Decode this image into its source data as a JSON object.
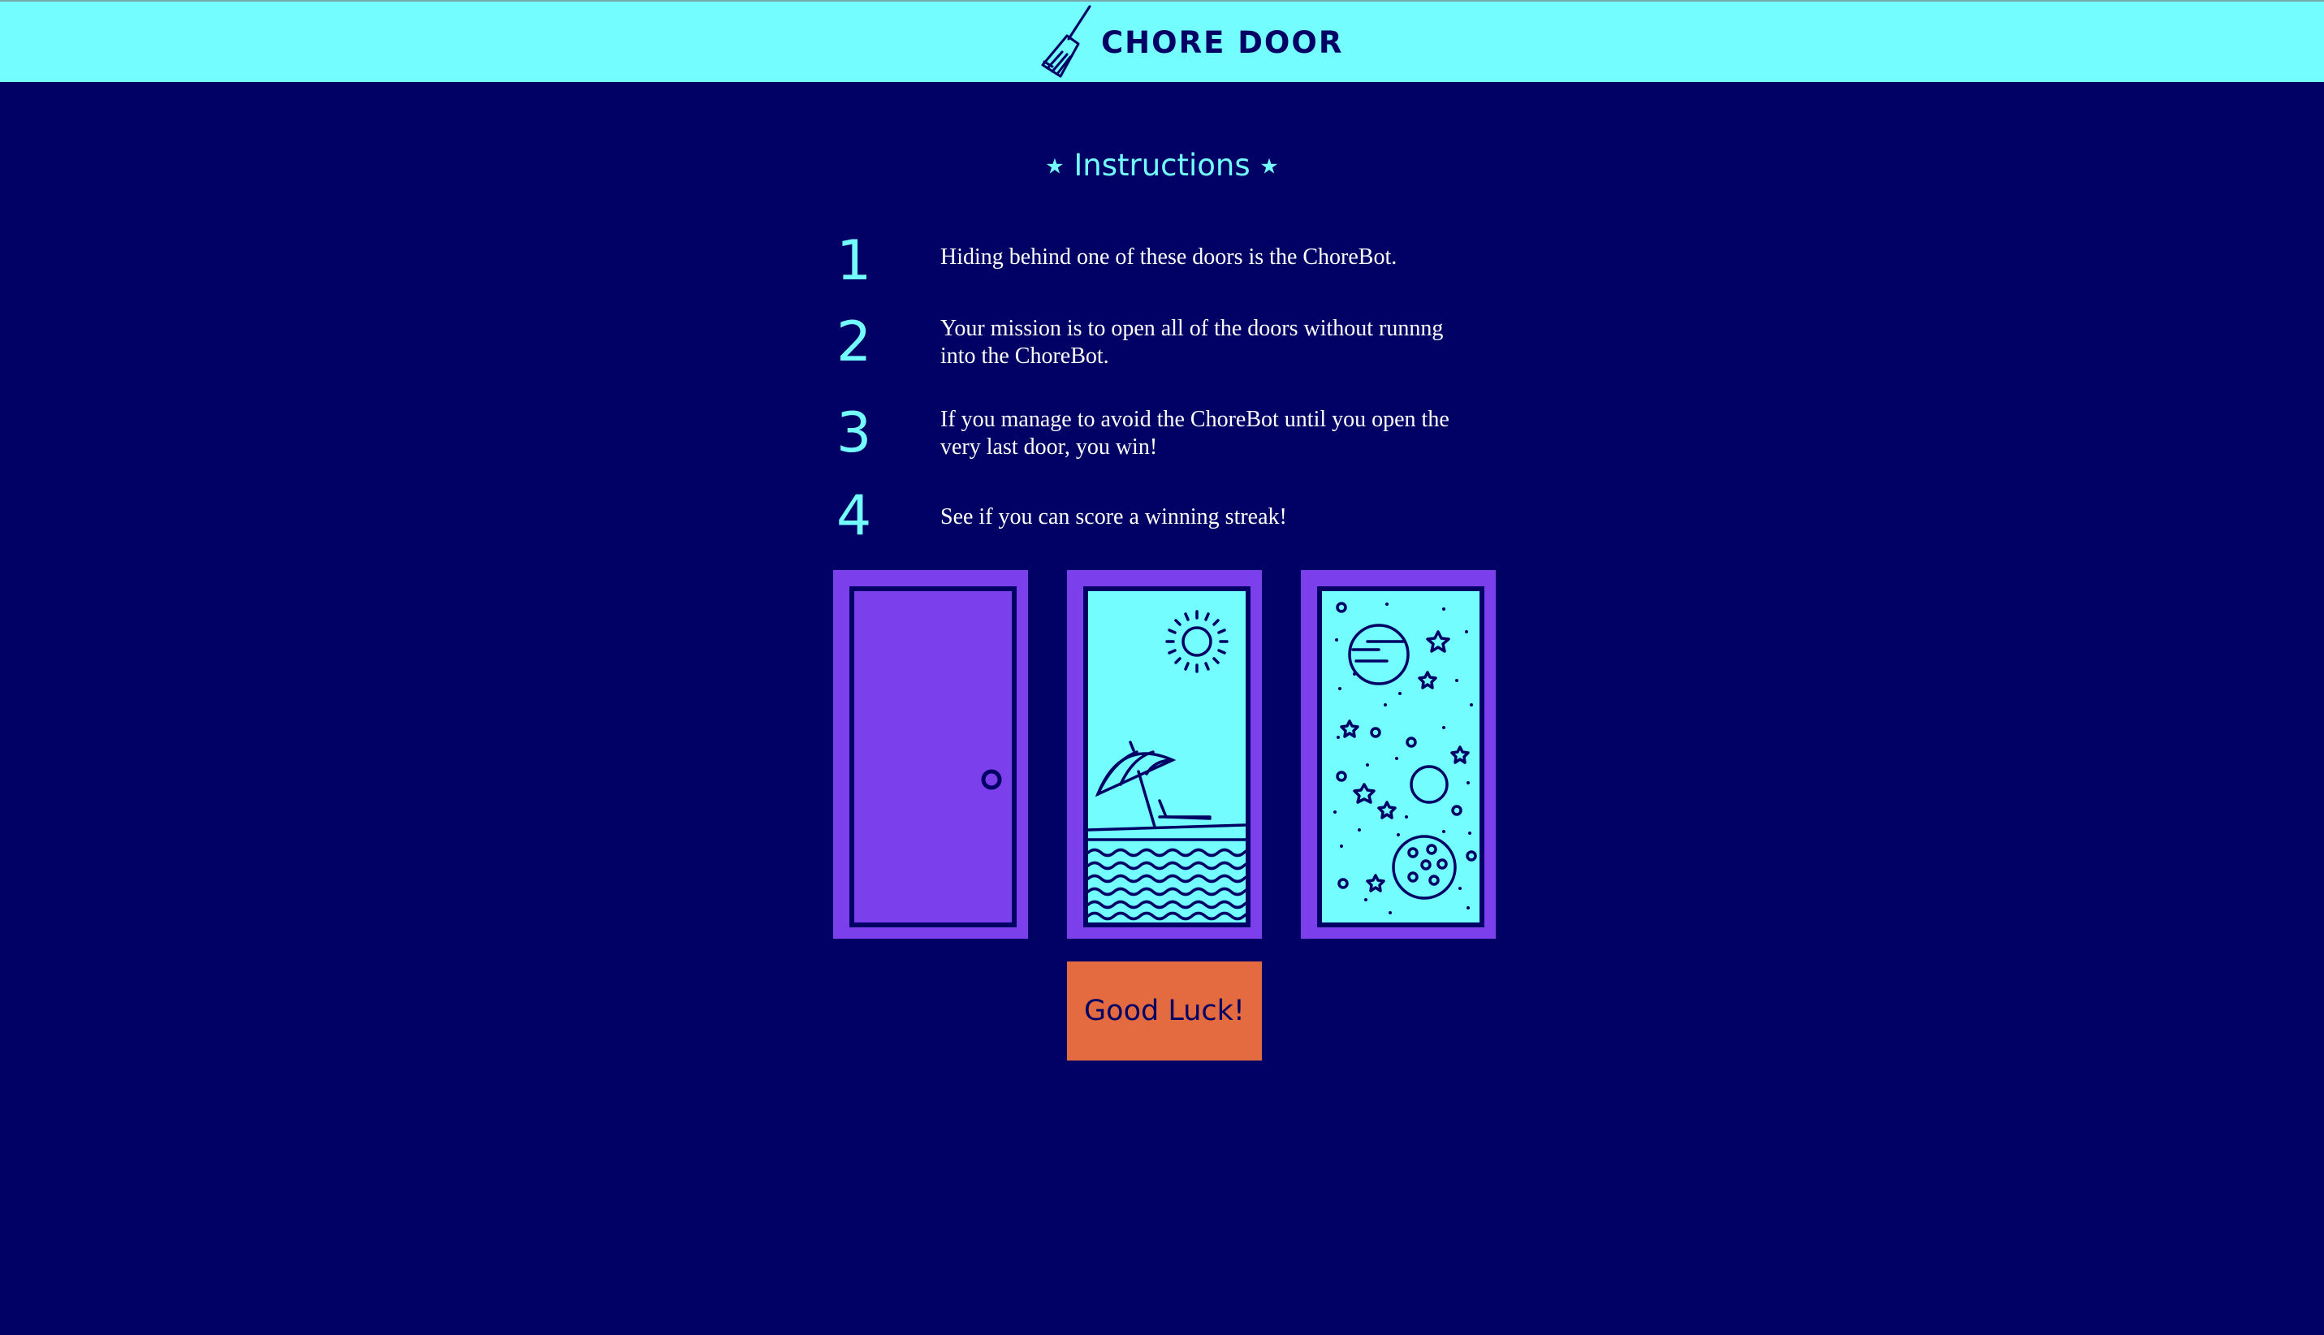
{
  "header": {
    "title": "CHORE DOOR",
    "logo_icon": "broom-icon"
  },
  "instructions": {
    "title": "Instructions",
    "star_glyph": "★",
    "steps": [
      {
        "number": "1",
        "text": "Hiding behind one of these doors is the ChoreBot."
      },
      {
        "number": "2",
        "text": "Your mission is to open all of the doors without runnng into the ChoreBot."
      },
      {
        "number": "3",
        "text": "If you manage to avoid the ChoreBot until you open the very last door, you win!"
      },
      {
        "number": "4",
        "text": "See if you can score a winning streak!"
      }
    ]
  },
  "doors": [
    {
      "state": "closed",
      "image": "closed-door"
    },
    {
      "state": "open",
      "image": "beach-scene"
    },
    {
      "state": "open",
      "image": "space-scene"
    }
  ],
  "start_button": {
    "label": "Good Luck!"
  },
  "colors": {
    "background": "#010165",
    "header": "#73fdff",
    "door": "#7b3fec",
    "button": "#e46b3f",
    "accent_text": "#73fdff"
  }
}
